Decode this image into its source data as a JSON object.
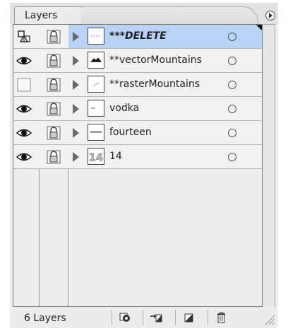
{
  "panel": {
    "tab_label": "Layers"
  },
  "layers": [
    {
      "name": "***DELETE",
      "visible": "template-icon",
      "selected": true,
      "style": "bold-italic",
      "thumb": "dashed-line-thumb"
    },
    {
      "name": "**vectorMountains",
      "visible": "eye-icon",
      "selected": false,
      "style": "normal",
      "thumb": "mountain-thumb"
    },
    {
      "name": "**rasterMountains",
      "visible": "hidden",
      "selected": false,
      "style": "normal",
      "thumb": "dots-thumb"
    },
    {
      "name": "vodka",
      "visible": "eye-icon",
      "selected": false,
      "style": "normal",
      "thumb": "line-thumb"
    },
    {
      "name": "fourteen",
      "visible": "eye-icon",
      "selected": false,
      "style": "normal",
      "thumb": "small-text-thumb"
    },
    {
      "name": "14",
      "visible": "eye-icon",
      "selected": false,
      "style": "normal",
      "thumb": "number-14-thumb"
    }
  ],
  "footer": {
    "layer_count": "6 Layers",
    "buttons": [
      "make-clipping-mask-icon",
      "create-sublayer-icon",
      "create-new-layer-icon",
      "delete-layer-icon"
    ]
  },
  "colors": {
    "selected_row": "#b9d3f7",
    "panel_bg": "#ececec"
  }
}
